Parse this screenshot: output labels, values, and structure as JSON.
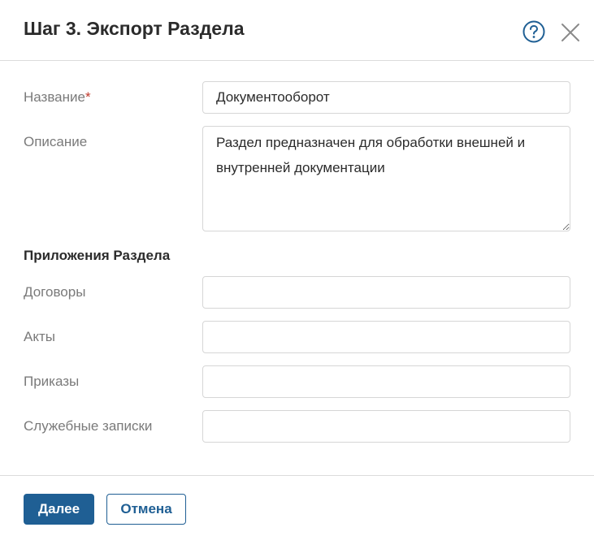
{
  "dialog": {
    "title": "Шаг 3. Экспорт Раздела",
    "accent_color": "#1f5f94",
    "icons": {
      "help": "help-circle-icon",
      "close": "close-icon"
    }
  },
  "form": {
    "name": {
      "label": "Название",
      "required_mark": "*",
      "value": "Документооборот"
    },
    "description": {
      "label": "Описание",
      "value": "Раздел предназначен для обработки внешней и внутренней документации"
    }
  },
  "apps_section": {
    "title": "Приложения Раздела",
    "items": [
      {
        "label": "Договоры",
        "value": ""
      },
      {
        "label": "Акты",
        "value": ""
      },
      {
        "label": "Приказы",
        "value": ""
      },
      {
        "label": "Служебные записки",
        "value": ""
      }
    ]
  },
  "footer": {
    "next_label": "Далее",
    "cancel_label": "Отмена"
  }
}
